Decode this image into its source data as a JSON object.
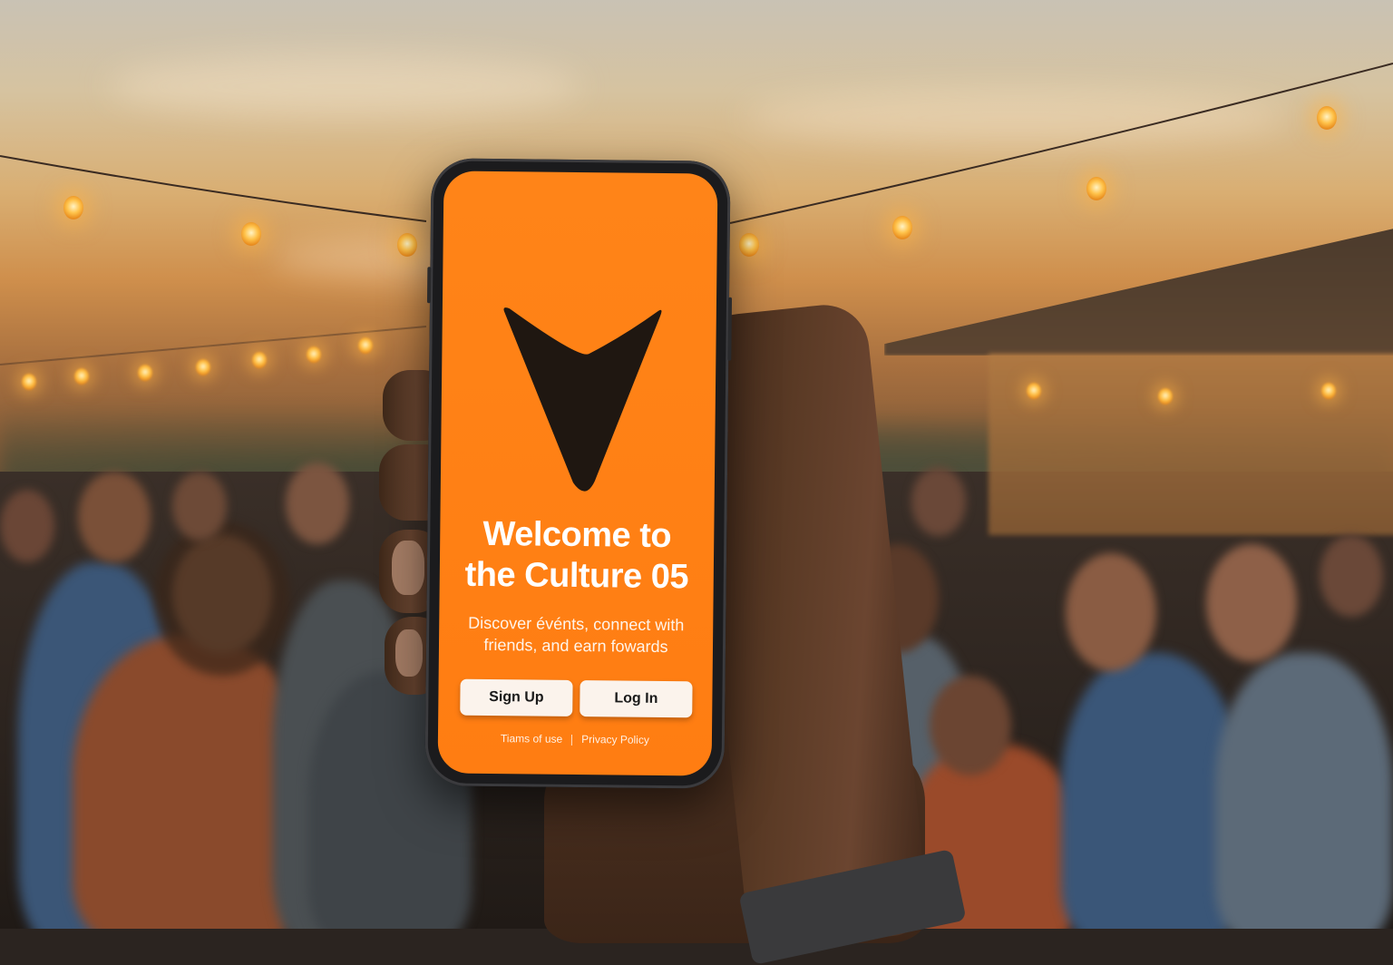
{
  "welcome": {
    "title_line1": "Welcome to",
    "title_line2": "the Culture 05",
    "subtitle_line1": "Discover événts, connect with",
    "subtitle_line2": "friends, and earn fowards"
  },
  "buttons": {
    "signup_label": "Sign Up",
    "login_label": "Log In"
  },
  "legal": {
    "terms_label": "Tiams of use",
    "privacy_label": "Privacy Policy"
  },
  "icons": {
    "logo": "arrowhead-logo-icon"
  },
  "colors": {
    "screen_background": "#ff8216",
    "logo_color": "#1f1711",
    "button_background": "#fbf3ec",
    "text_color": "#ffffff"
  }
}
